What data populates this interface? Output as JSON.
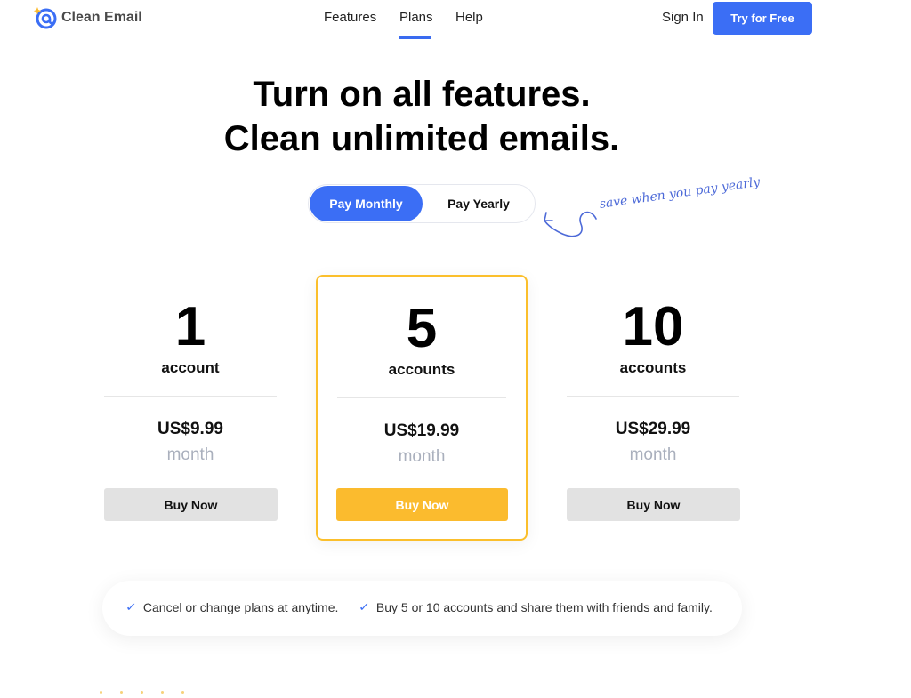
{
  "brand": {
    "name": "Clean Email",
    "logo_icon": "at-sign-sparkle-icon",
    "accent": "#3b6ef5",
    "highlight": "#fbbb2e"
  },
  "nav": {
    "items": [
      {
        "label": "Features"
      },
      {
        "label": "Plans",
        "active": true
      },
      {
        "label": "Help"
      }
    ],
    "signin_label": "Sign In",
    "cta_label": "Try for Free"
  },
  "hero": {
    "line1": "Turn on all features.",
    "line2": "Clean unlimited emails."
  },
  "billing": {
    "monthly_label": "Pay Monthly",
    "yearly_label": "Pay Yearly",
    "selected": "monthly",
    "note": "save when you pay yearly"
  },
  "plans": [
    {
      "count": "1",
      "unit": "account",
      "price": "US$9.99",
      "period": "month",
      "button": "Buy Now"
    },
    {
      "count": "5",
      "unit": "accounts",
      "price": "US$19.99",
      "period": "month",
      "button": "Buy Now",
      "featured": true
    },
    {
      "count": "10",
      "unit": "accounts",
      "price": "US$29.99",
      "period": "month",
      "button": "Buy Now"
    }
  ],
  "features": [
    {
      "icon": "check-icon",
      "text": "Cancel or change plans at anytime."
    },
    {
      "icon": "check-icon",
      "text": "Buy 5 or 10 accounts and share them with friends and family."
    }
  ]
}
